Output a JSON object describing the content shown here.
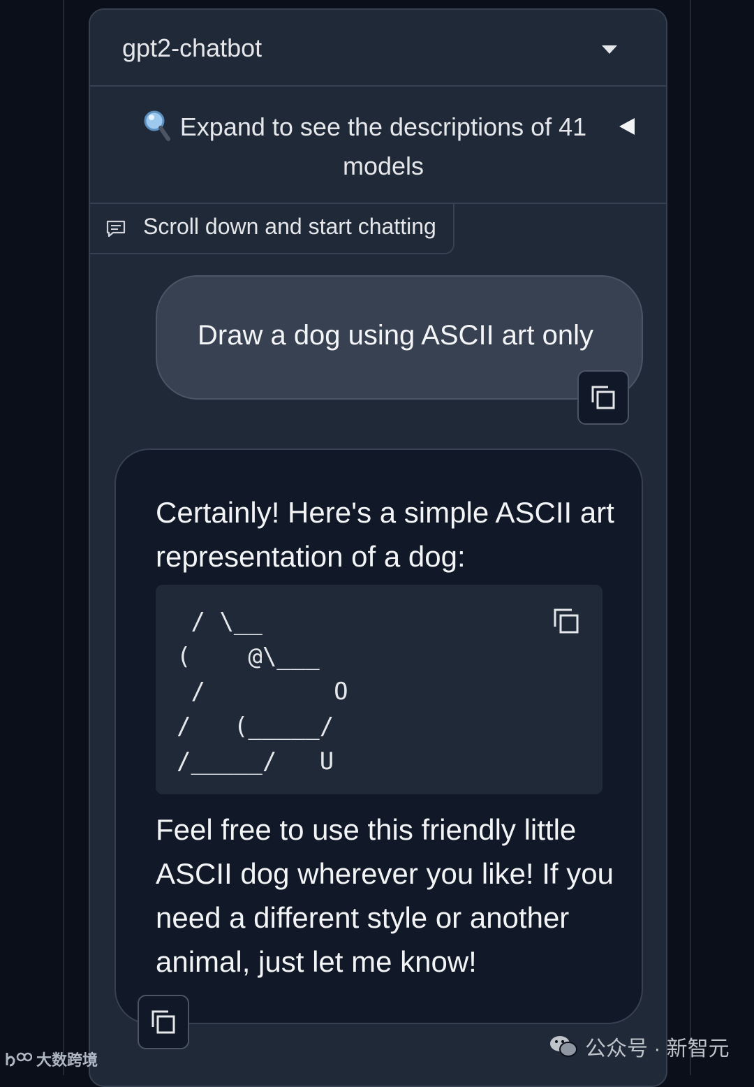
{
  "model_selector": {
    "selected": "gpt2-chatbot",
    "icon": "chevron-down-icon"
  },
  "model_accordion": {
    "title": "Expand to see the descriptions of 41 models",
    "icon": "magnifier-icon",
    "toggle_icon": "triangle-left-icon"
  },
  "chatbot": {
    "label": "Scroll down and start chatting",
    "label_icon": "chat-bubble-icon",
    "messages": [
      {
        "role": "user",
        "text": "Draw a dog using ASCII art only"
      },
      {
        "role": "assistant",
        "intro": "Certainly! Here's a simple ASCII art representation of a dog:",
        "code": " / \\__\n(    @\\___\n /         O\n/   (_____/\n/_____/   U",
        "outro": "Feel free to use this friendly little ASCII dog wherever you like! If you need a different style or another animal, just let me know!"
      }
    ]
  },
  "watermarks": {
    "left": "大数跨境",
    "right": "公众号 · 新智元"
  },
  "colors": {
    "page_bg": "#0b0f19",
    "panel_bg": "#1f2937",
    "border": "#374151",
    "user_bubble": "#374151",
    "bot_bubble": "#111827"
  }
}
